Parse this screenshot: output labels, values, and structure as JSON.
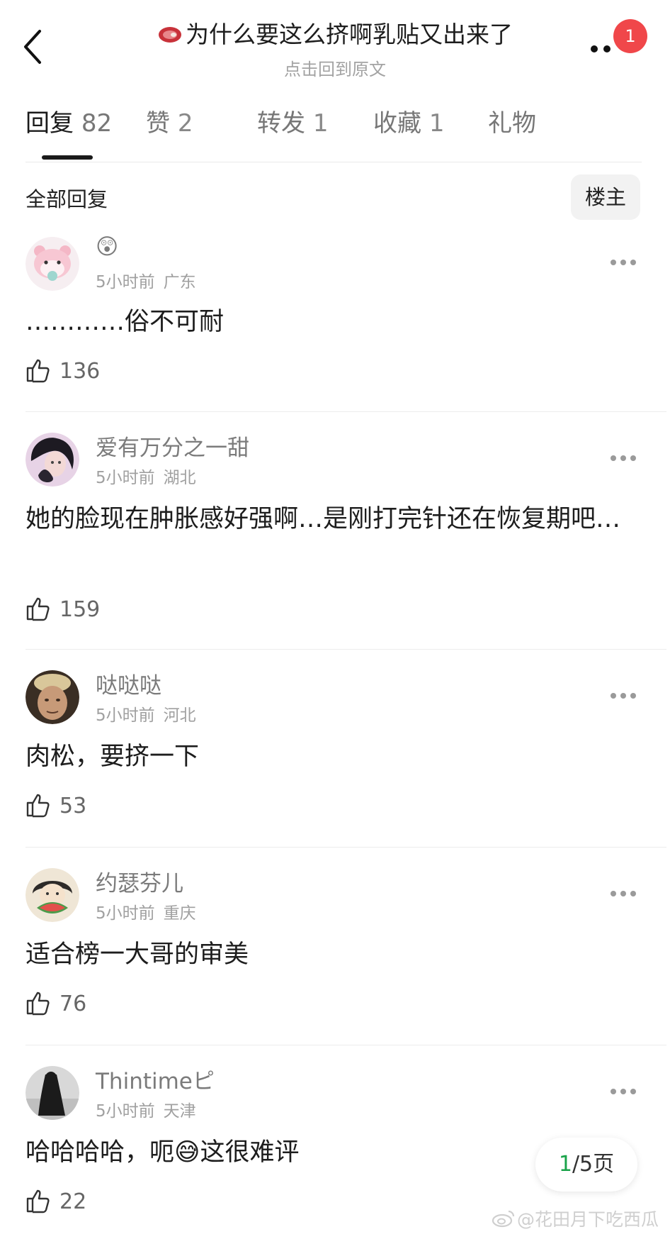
{
  "header": {
    "title": "为什么要这么挤啊乳贴又出来了",
    "title_icon": "meat-emoji",
    "subtitle": "点击回到原文",
    "notification_count": "1"
  },
  "tabs": [
    {
      "label": "回复",
      "count": "82",
      "active": true
    },
    {
      "label": "赞",
      "count": "2"
    },
    {
      "label": "转发",
      "count": "1"
    },
    {
      "label": "收藏",
      "count": "1"
    },
    {
      "label": "礼物",
      "count": ""
    }
  ],
  "filter": {
    "label": "全部回复",
    "op_button": "楼主"
  },
  "comments": [
    {
      "name": "😲",
      "time": "5小时前",
      "location": "广东",
      "text": "…………俗不可耐",
      "likes": "136",
      "avatar": "pink-bear"
    },
    {
      "name": "爱有万分之一甜",
      "time": "5小时前",
      "location": "湖北",
      "text": "她的脸现在肿胀感好强啊…是刚打完针还在恢复期吧…",
      "likes": "159",
      "avatar": "anime-girl"
    },
    {
      "name": "哒哒哒",
      "time": "5小时前",
      "location": "河北",
      "text": "肉松，要挤一下",
      "likes": "53",
      "avatar": "man-hat"
    },
    {
      "name": "约瑟芬儿",
      "time": "5小时前",
      "location": "重庆",
      "text": "适合榜一大哥的审美",
      "likes": "76",
      "avatar": "girl-watermelon"
    },
    {
      "name": "Thintimeピ",
      "time": "5小时前",
      "location": "天津",
      "text": "哈哈哈哈，呃😅这很难评",
      "likes": "22",
      "avatar": "dark-figure"
    }
  ],
  "pagination": {
    "current": "1",
    "total": "/5页"
  },
  "watermark": "@花田月下吃西瓜",
  "colors": {
    "badge": "#f0474a",
    "page_current": "#1aa34a",
    "divider": "#ececec"
  }
}
